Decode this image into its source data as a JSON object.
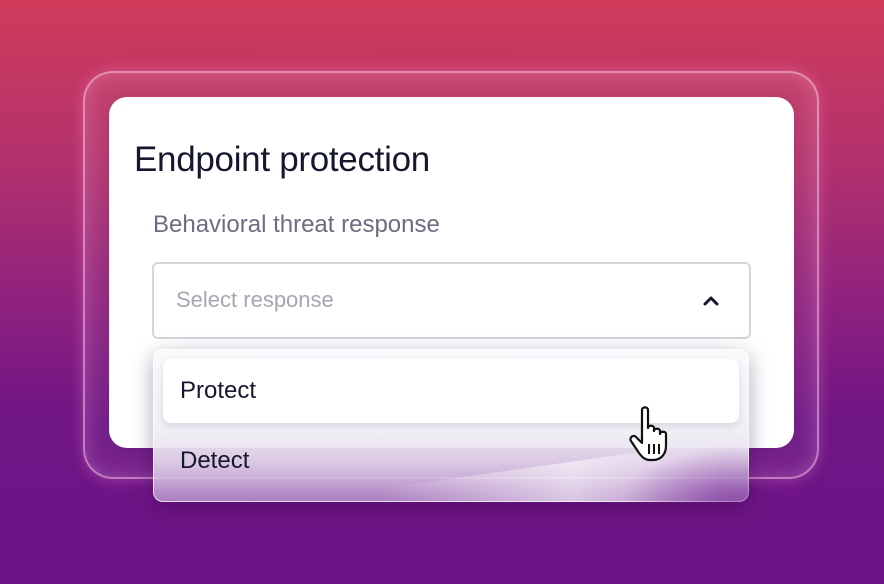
{
  "card": {
    "title": "Endpoint protection"
  },
  "field": {
    "label": "Behavioral threat response",
    "placeholder": "Select response",
    "state": "expanded"
  },
  "dropdown": {
    "options": [
      {
        "label": "Protect",
        "highlighted": true
      },
      {
        "label": "Detect",
        "highlighted": false
      }
    ]
  },
  "icons": {
    "chevron": "chevron-up-icon",
    "cursor": "hand-pointer-cursor-icon"
  },
  "colors": {
    "background_top": "#d03c5a",
    "background_bottom": "#6e1487",
    "title_text": "#15172e",
    "label_text": "#6c6e80",
    "placeholder_text": "#a5a6b2",
    "select_border": "#d5d6dc"
  }
}
